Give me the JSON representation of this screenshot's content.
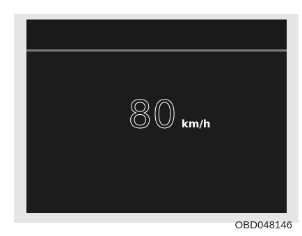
{
  "display": {
    "speed_value": "80",
    "speed_unit": "km/h"
  },
  "caption": {
    "figure_code": "OBD048146"
  },
  "colors": {
    "panel_background": "#1c1c1c",
    "divider": "#7d7d7d",
    "text": "#ffffff",
    "frame_background": "#e6e6e6"
  }
}
